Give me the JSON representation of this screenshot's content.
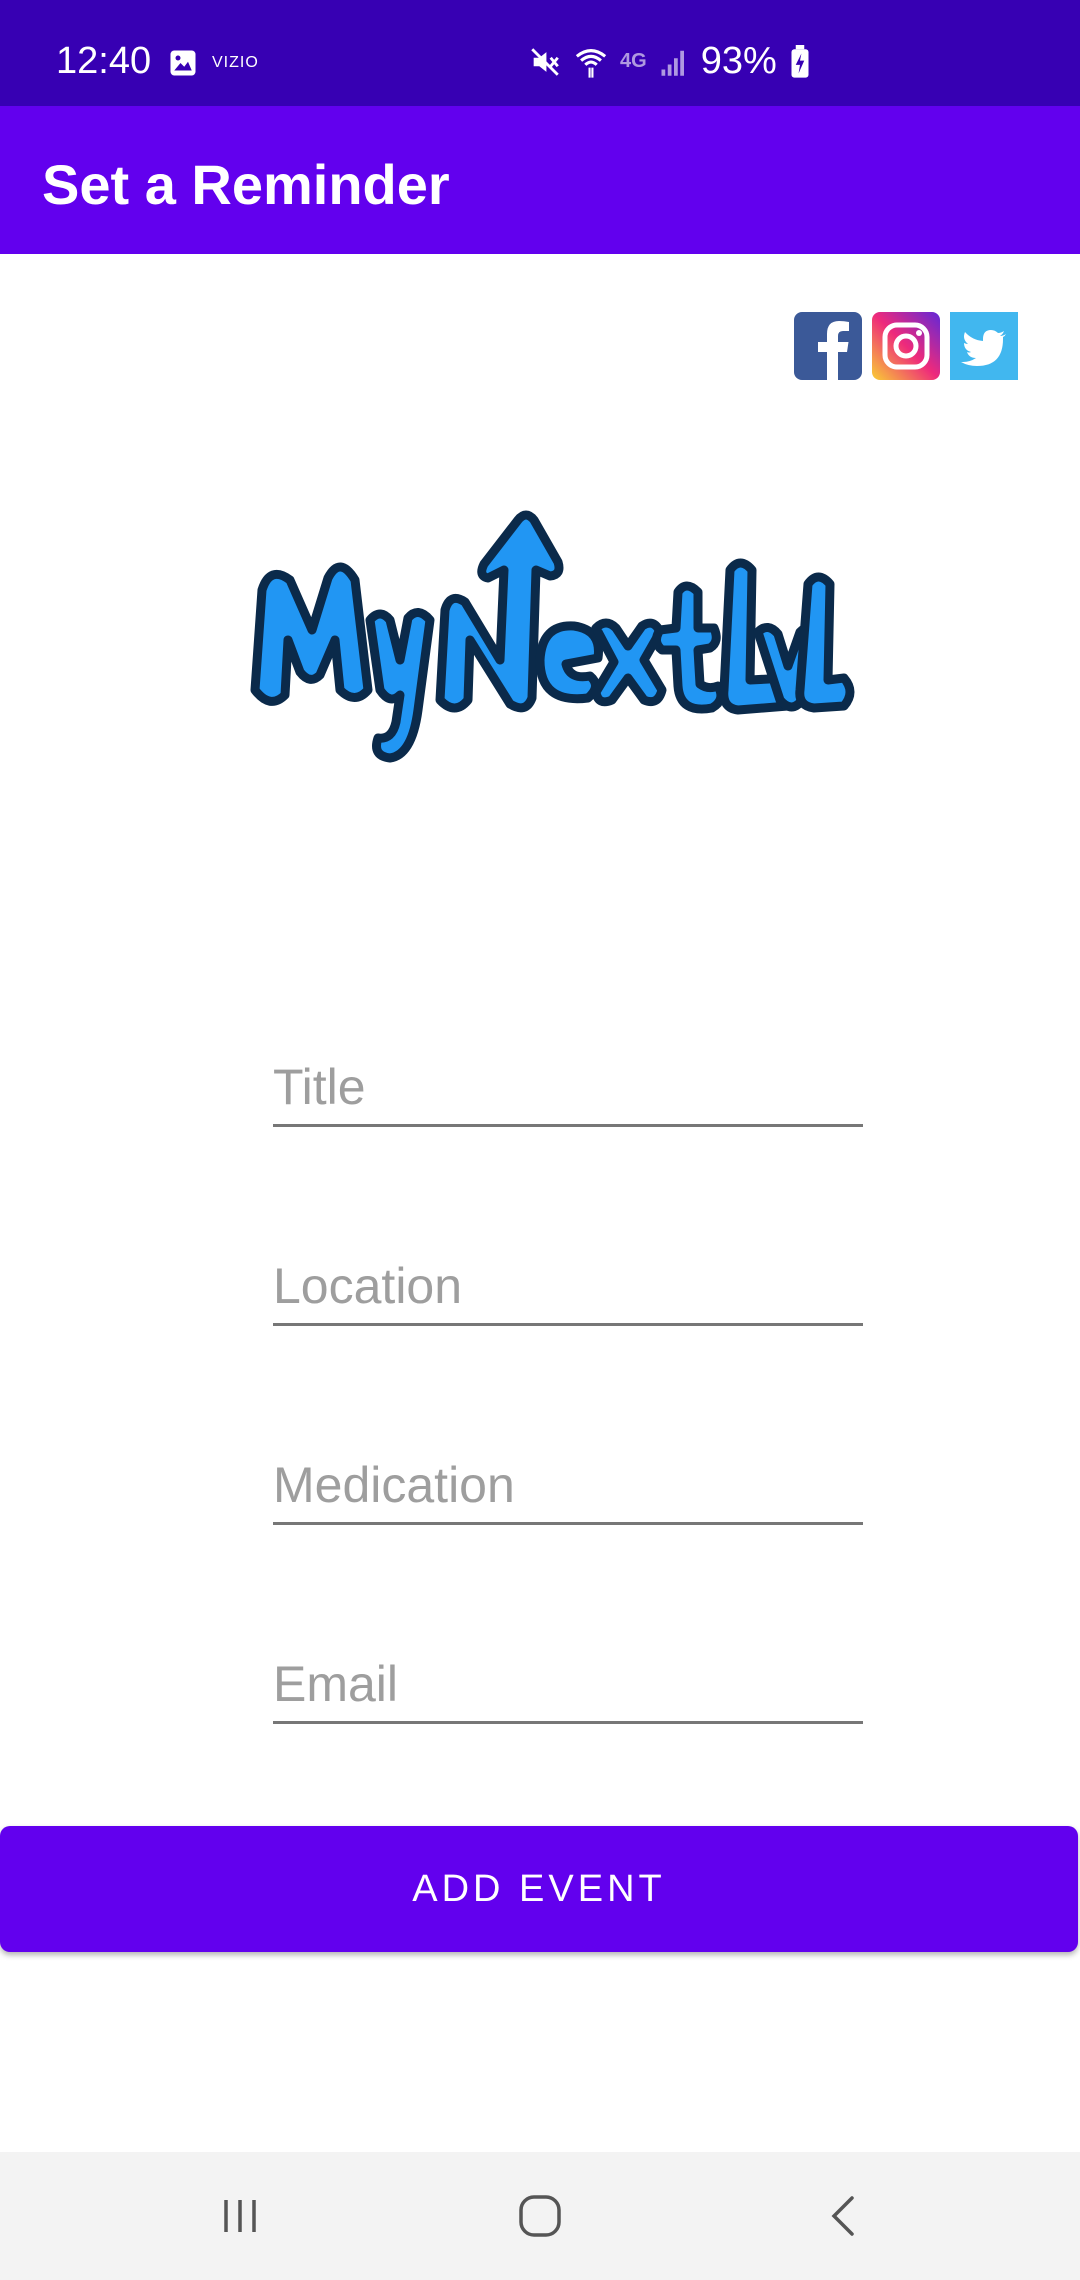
{
  "status_bar": {
    "time": "12:40",
    "carrier_badge": "VIZIO",
    "network": "4G",
    "battery": "93%"
  },
  "app_bar": {
    "title": "Set a Reminder"
  },
  "social": {
    "icons": [
      "facebook-icon",
      "instagram-icon",
      "twitter-icon"
    ]
  },
  "logo": {
    "text": "MyNextLvL"
  },
  "form": {
    "title_placeholder": "Title",
    "location_placeholder": "Location",
    "medication_placeholder": "Medication",
    "email_placeholder": "Email"
  },
  "actions": {
    "add_event_label": "ADD EVENT"
  },
  "colors": {
    "status_bar": "#3700b3",
    "primary": "#6200ee",
    "logo_fill": "#2196f3"
  },
  "nav_bar": {
    "icons": [
      "recent-apps-icon",
      "home-icon",
      "back-icon"
    ]
  }
}
